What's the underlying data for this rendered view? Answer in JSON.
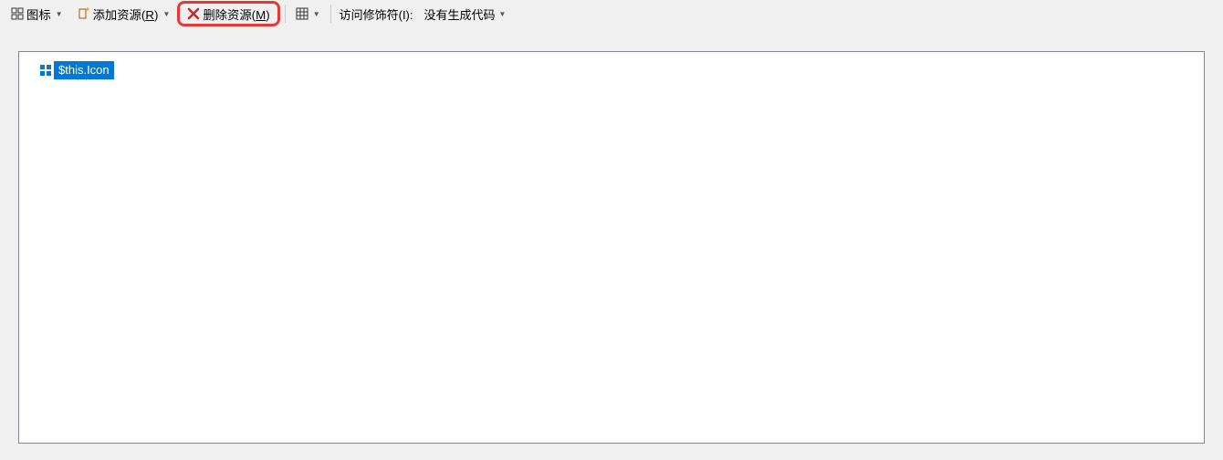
{
  "toolbar": {
    "view_label": "图标",
    "add_resource_label": "添加资源(",
    "add_resource_hotkey": "R",
    "add_resource_suffix": ")",
    "delete_resource_label": "删除资源(",
    "delete_resource_hotkey": "M",
    "delete_resource_suffix": ")",
    "access_modifier_label": "访问修饰符(I):",
    "access_modifier_value": "没有生成代码"
  },
  "content": {
    "selected_item_label": "$this.Icon"
  }
}
